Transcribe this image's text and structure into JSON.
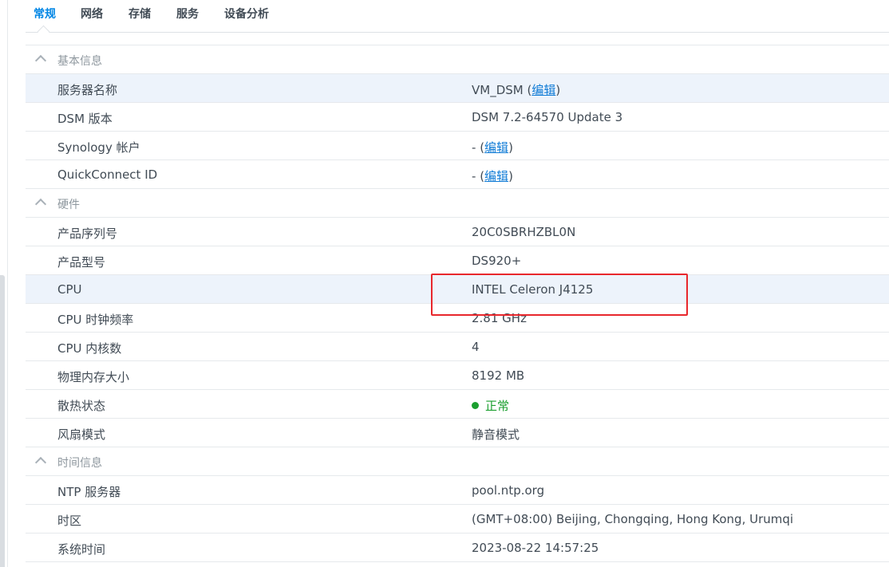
{
  "tabs": [
    {
      "label": "常规"
    },
    {
      "label": "网络"
    },
    {
      "label": "存储"
    },
    {
      "label": "服务"
    },
    {
      "label": "设备分析"
    }
  ],
  "sections": {
    "basic": {
      "title": "基本信息",
      "server_name": {
        "label": "服务器名称",
        "value": "VM_DSM",
        "edit": "编辑"
      },
      "dsm_version": {
        "label": "DSM 版本",
        "value": "DSM 7.2-64570 Update 3"
      },
      "synology_account": {
        "label": "Synology 帐户",
        "value": "-",
        "edit": "编辑"
      },
      "quickconnect": {
        "label": "QuickConnect ID",
        "value": "-",
        "edit": "编辑"
      }
    },
    "hardware": {
      "title": "硬件",
      "serial": {
        "label": "产品序列号",
        "value": "20C0SBRHZBL0N"
      },
      "model": {
        "label": "产品型号",
        "value": "DS920+"
      },
      "cpu": {
        "label": "CPU",
        "value": "INTEL Celeron J4125"
      },
      "cpu_clock": {
        "label": "CPU 时钟频率",
        "value": "2.81 GHz"
      },
      "cpu_cores": {
        "label": "CPU 内核数",
        "value": "4"
      },
      "memory": {
        "label": "物理内存大小",
        "value": "8192 MB"
      },
      "thermal": {
        "label": "散热状态",
        "value": "正常"
      },
      "fan": {
        "label": "风扇模式",
        "value": "静音模式"
      }
    },
    "time": {
      "title": "时间信息",
      "ntp": {
        "label": "NTP 服务器",
        "value": "pool.ntp.org"
      },
      "timezone": {
        "label": "时区",
        "value": "(GMT+08:00) Beijing, Chongqing, Hong Kong, Urumqi"
      },
      "system_time": {
        "label": "系统时间",
        "value": "2023-08-22 14:57:25"
      }
    }
  },
  "colors": {
    "accent": "#0086e5",
    "highlight_row": "#edf3fb",
    "status_ok": "#1b9f2f",
    "annotation_box": "#e8272c"
  }
}
